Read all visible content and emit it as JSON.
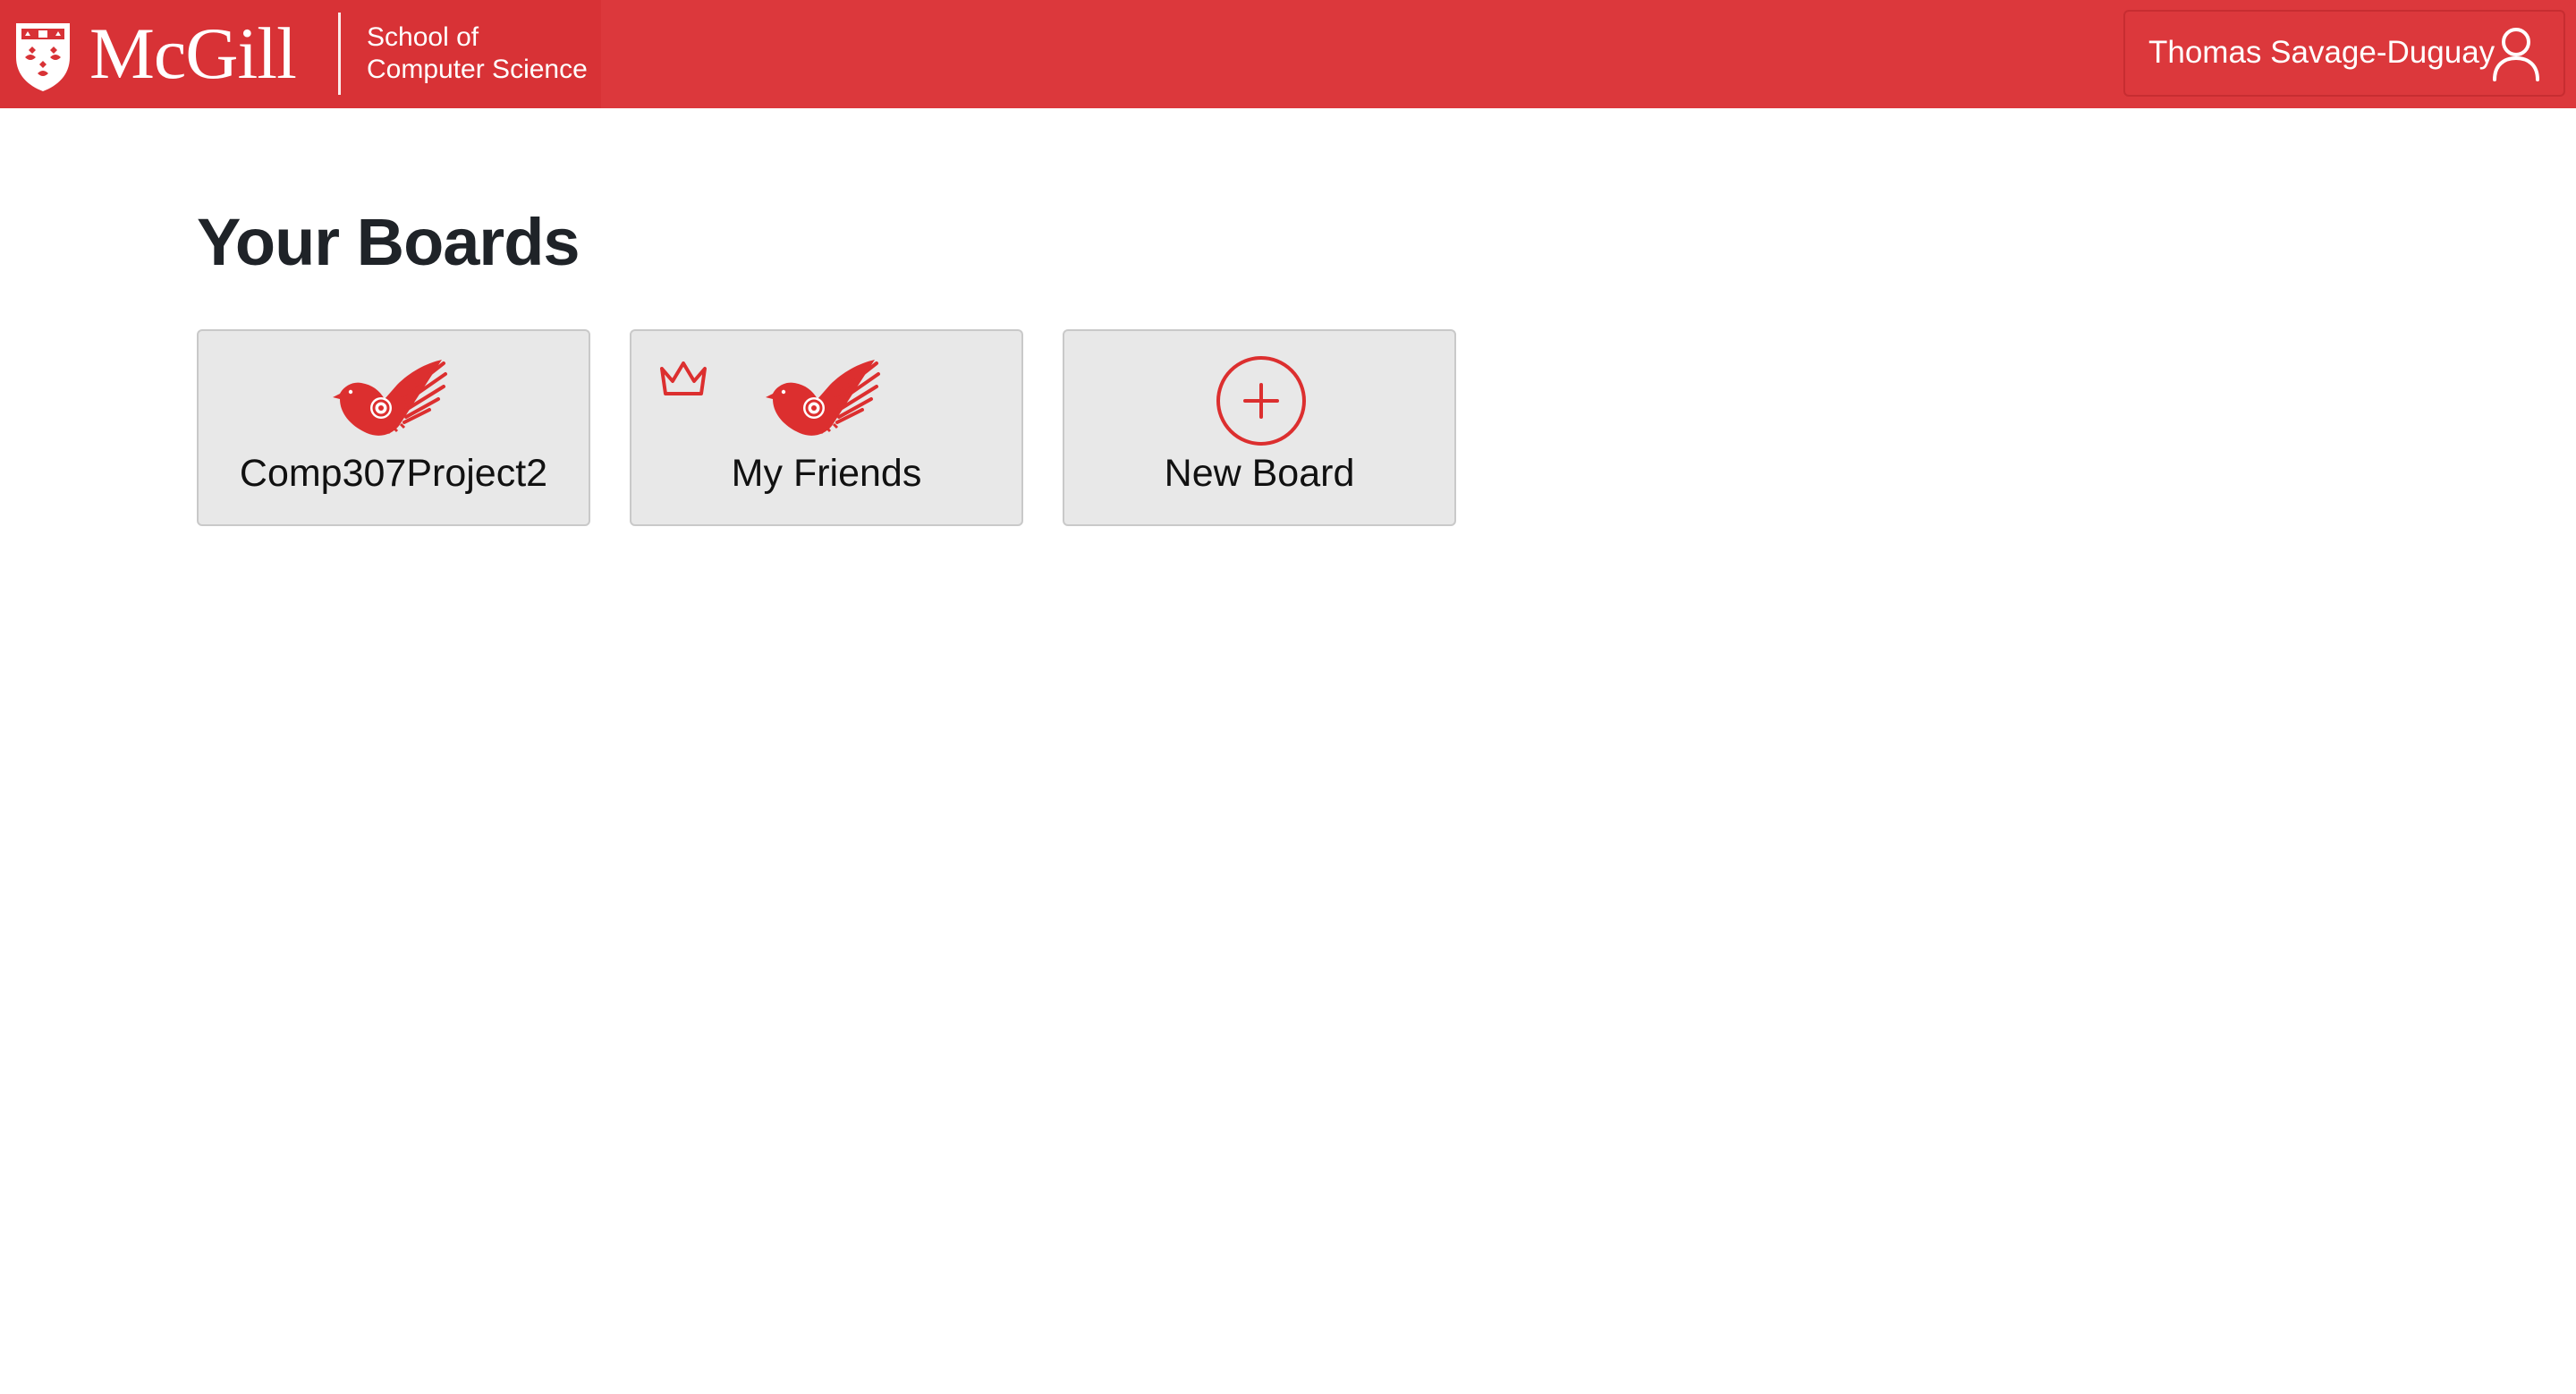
{
  "header": {
    "logo_text": "McGill",
    "school_line1": "School of",
    "school_line2": "Computer Science",
    "user_name": "Thomas Savage-Duguay",
    "user_icon": "user-icon"
  },
  "page": {
    "title": "Your Boards"
  },
  "boards": [
    {
      "label": "Comp307Project2",
      "icon": "bird-icon",
      "owner": false
    },
    {
      "label": "My Friends",
      "icon": "bird-icon",
      "owner": true,
      "badge_icon": "crown-icon"
    },
    {
      "label": "New Board",
      "icon": "plus-circle-icon"
    }
  ],
  "colors": {
    "header_bg": "#dc383c",
    "accent": "#dc2f2f",
    "card_bg": "#e8e8e8",
    "title_text": "#1f2328"
  }
}
